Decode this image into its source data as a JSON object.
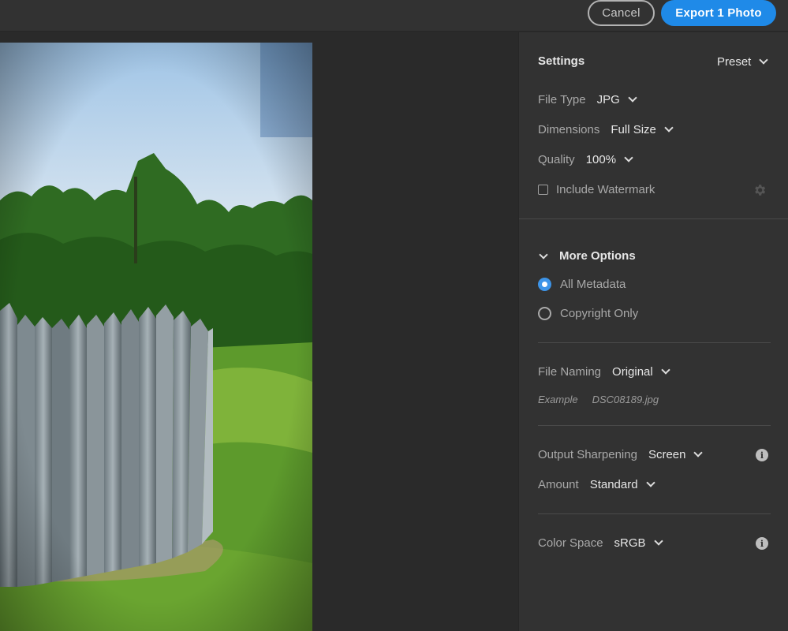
{
  "header": {
    "cancel_label": "Cancel",
    "export_label": "Export 1 Photo"
  },
  "preview": {
    "image_desc_icon": "photo-preview"
  },
  "settings": {
    "title": "Settings",
    "preset_label": "Preset",
    "file_type": {
      "label": "File Type",
      "value": "JPG"
    },
    "dimensions": {
      "label": "Dimensions",
      "value": "Full Size"
    },
    "quality": {
      "label": "Quality",
      "value": "100%"
    },
    "watermark": {
      "label": "Include Watermark",
      "checked": false
    }
  },
  "more_options": {
    "title": "More Options",
    "metadata_options": [
      {
        "label": "All Metadata",
        "selected": true
      },
      {
        "label": "Copyright Only",
        "selected": false
      }
    ],
    "file_naming": {
      "label": "File Naming",
      "value": "Original"
    },
    "example": {
      "label": "Example",
      "value": "DSC08189.jpg"
    },
    "output_sharpening": {
      "label": "Output Sharpening",
      "value": "Screen"
    },
    "amount": {
      "label": "Amount",
      "value": "Standard"
    },
    "color_space": {
      "label": "Color Space",
      "value": "sRGB"
    }
  },
  "colors": {
    "accent": "#1f8ae8",
    "panel_bg": "#323232",
    "canvas_bg": "#2a2a2a"
  },
  "icons": [
    "chevron-down-icon",
    "gear-icon",
    "info-icon",
    "checkbox-icon",
    "radio-icon"
  ]
}
